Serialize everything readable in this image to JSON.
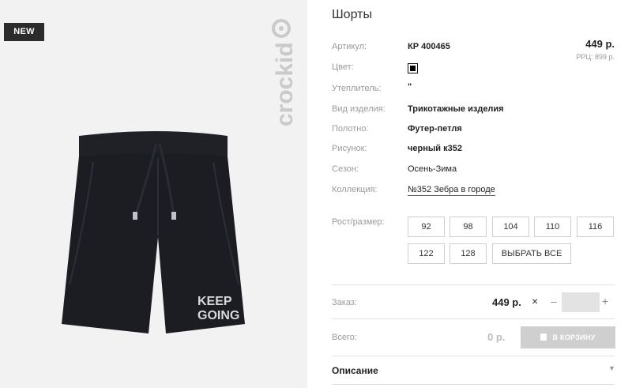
{
  "photo": {
    "badge": "NEW",
    "brand": "crockid",
    "print_text_line1": "KEEP",
    "print_text_line2": "GOING"
  },
  "product": {
    "title": "Шорты",
    "price": "449 р.",
    "rrp": "РРЦ: 899 р.",
    "attributes": [
      {
        "label": "Артикул:",
        "value": "КР 400465"
      },
      {
        "label": "Цвет:",
        "value": "#000000"
      },
      {
        "label": "Утеплитель:",
        "value": "\""
      },
      {
        "label": "Вид изделия:",
        "value": "Трикотажные изделия"
      },
      {
        "label": "Полотно:",
        "value": "Футер-петля"
      },
      {
        "label": "Рисунок:",
        "value": "черный к352"
      },
      {
        "label": "Сезон:",
        "value": "Осень-Зима"
      },
      {
        "label": "Коллекция:",
        "value": "№352 Зебра в городе"
      }
    ],
    "size_label": "Рост/размер:",
    "sizes": [
      "92",
      "98",
      "104",
      "110",
      "116",
      "122",
      "128"
    ],
    "select_all": "ВЫБРАТЬ ВСЕ"
  },
  "order": {
    "label": "Заказ:",
    "price": "449 р.",
    "remove_icon": "×",
    "minus": "–",
    "plus": "+",
    "quantity": ""
  },
  "total": {
    "label": "Всего:",
    "value": "0 р.",
    "cart_button": "В КОРЗИНУ"
  },
  "description": {
    "label": "Описание",
    "caret": "▼"
  },
  "colors": {
    "badge_bg": "#2b2b2b",
    "photo_bg": "#f2f2f2",
    "garment": "#1b1d22",
    "cart_button_bg": "#cfcfcf",
    "qty_bg": "#e3e3e3"
  }
}
